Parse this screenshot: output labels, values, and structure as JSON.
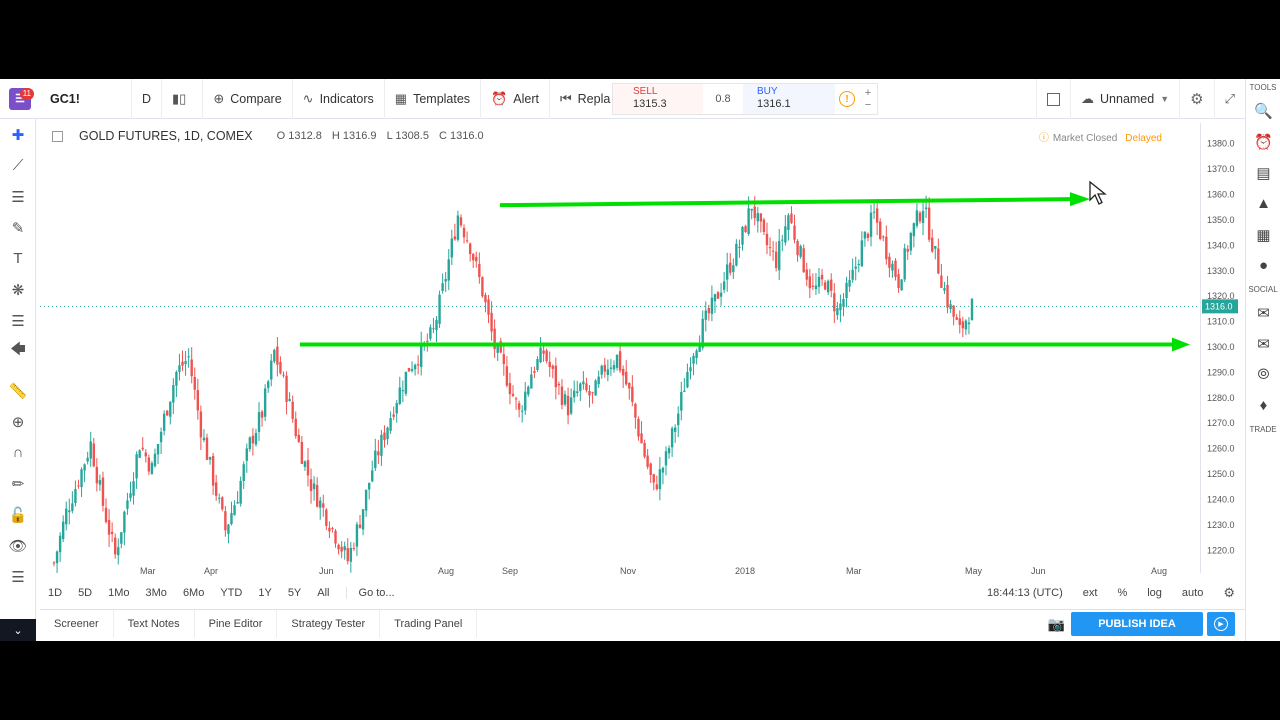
{
  "toolbar": {
    "notification_count": "11",
    "symbol": "GC1!",
    "interval": "D",
    "compare_label": "Compare",
    "indicators_label": "Indicators",
    "templates_label": "Templates",
    "alert_label": "Alert",
    "replay_label": "Repla",
    "sell_label": "SELL",
    "sell_price": "1315.3",
    "spread": "0.8",
    "buy_label": "BUY",
    "buy_price": "1316.1",
    "layout_name": "Unnamed"
  },
  "legend": {
    "title": "GOLD FUTURES, 1D, COMEX",
    "open": "O 1312.8",
    "high": "H 1316.9",
    "low": "L 1308.5",
    "close": "C 1316.0",
    "market_status": "Market Closed",
    "delayed": "Delayed"
  },
  "price_scale": {
    "labels": [
      "1380.0",
      "1370.0",
      "1360.0",
      "1350.0",
      "1340.0",
      "1330.0",
      "1320.0",
      "1310.0",
      "1300.0",
      "1290.0",
      "1280.0",
      "1270.0",
      "1260.0",
      "1250.0",
      "1240.0",
      "1230.0",
      "1220.0"
    ],
    "current_price": "1316.0"
  },
  "time_axis": {
    "labels": [
      "Mar",
      "Apr",
      "Jun",
      "Aug",
      "Sep",
      "Nov",
      "2018",
      "Mar",
      "May",
      "Jun",
      "Aug"
    ]
  },
  "range_bar": {
    "ranges": [
      "1D",
      "5D",
      "1Mo",
      "3Mo",
      "6Mo",
      "YTD",
      "1Y",
      "5Y",
      "All"
    ],
    "goto_label": "Go to...",
    "clock": "18:44:13 (UTC)",
    "ext": "ext",
    "percent": "%",
    "log": "log",
    "auto": "auto"
  },
  "bottom_panel": {
    "tabs": [
      "Screener",
      "Text Notes",
      "Pine Editor",
      "Strategy Tester",
      "Trading Panel"
    ],
    "publish_label": "PUBLISH IDEA"
  },
  "right_panel": {
    "tools_label": "TOOLS",
    "social_label": "SOCIAL",
    "trade_label": "TRADE"
  },
  "colors": {
    "up_candle": "#26a69a",
    "down_candle": "#ef5350",
    "annotation_line": "#00e000",
    "accent": "#2196f3",
    "brand": "#7b4fc9"
  },
  "chart_data": {
    "type": "candlestick",
    "symbol": "GOLD FUTURES",
    "interval": "1D",
    "exchange": "COMEX",
    "ylim": [
      1215,
      1385
    ],
    "last": {
      "open": 1312.8,
      "high": 1316.9,
      "low": 1308.5,
      "close": 1316.0
    },
    "series": [
      {
        "values": [
          [
            0,
            1215
          ],
          [
            4,
            1235
          ],
          [
            8,
            1248
          ],
          [
            12,
            1262
          ],
          [
            16,
            1238
          ],
          [
            20,
            1218
          ],
          [
            24,
            1240
          ],
          [
            28,
            1262
          ],
          [
            32,
            1252
          ],
          [
            36,
            1272
          ],
          [
            40,
            1290
          ],
          [
            44,
            1296
          ],
          [
            48,
            1268
          ],
          [
            52,
            1248
          ],
          [
            56,
            1228
          ],
          [
            60,
            1242
          ],
          [
            64,
            1262
          ],
          [
            68,
            1274
          ],
          [
            72,
            1298
          ],
          [
            76,
            1282
          ],
          [
            80,
            1262
          ],
          [
            84,
            1246
          ],
          [
            88,
            1236
          ],
          [
            92,
            1226
          ],
          [
            96,
            1216
          ],
          [
            100,
            1232
          ],
          [
            104,
            1252
          ],
          [
            108,
            1266
          ],
          [
            112,
            1280
          ],
          [
            116,
            1292
          ],
          [
            120,
            1298
          ],
          [
            124,
            1306
          ],
          [
            128,
            1328
          ],
          [
            132,
            1352
          ],
          [
            136,
            1340
          ],
          [
            140,
            1322
          ],
          [
            144,
            1300
          ],
          [
            148,
            1288
          ],
          [
            152,
            1274
          ],
          [
            156,
            1290
          ],
          [
            160,
            1298
          ],
          [
            164,
            1286
          ],
          [
            168,
            1276
          ],
          [
            172,
            1284
          ],
          [
            176,
            1280
          ],
          [
            180,
            1292
          ],
          [
            184,
            1296
          ],
          [
            188,
            1282
          ],
          [
            192,
            1262
          ],
          [
            196,
            1244
          ],
          [
            200,
            1256
          ],
          [
            204,
            1274
          ],
          [
            208,
            1296
          ],
          [
            212,
            1308
          ],
          [
            216,
            1318
          ],
          [
            220,
            1330
          ],
          [
            224,
            1340
          ],
          [
            228,
            1356
          ],
          [
            232,
            1342
          ],
          [
            236,
            1334
          ],
          [
            240,
            1352
          ],
          [
            244,
            1336
          ],
          [
            248,
            1322
          ],
          [
            252,
            1326
          ],
          [
            256,
            1314
          ],
          [
            260,
            1324
          ],
          [
            264,
            1340
          ],
          [
            268,
            1352
          ],
          [
            272,
            1338
          ],
          [
            276,
            1326
          ],
          [
            280,
            1344
          ],
          [
            284,
            1356
          ],
          [
            288,
            1336
          ],
          [
            292,
            1318
          ],
          [
            296,
            1306
          ],
          [
            300,
            1316
          ]
        ]
      }
    ],
    "annotations": [
      {
        "type": "horizontal-arrow",
        "price": 1357
      },
      {
        "type": "horizontal-arrow",
        "price": 1301
      }
    ]
  }
}
